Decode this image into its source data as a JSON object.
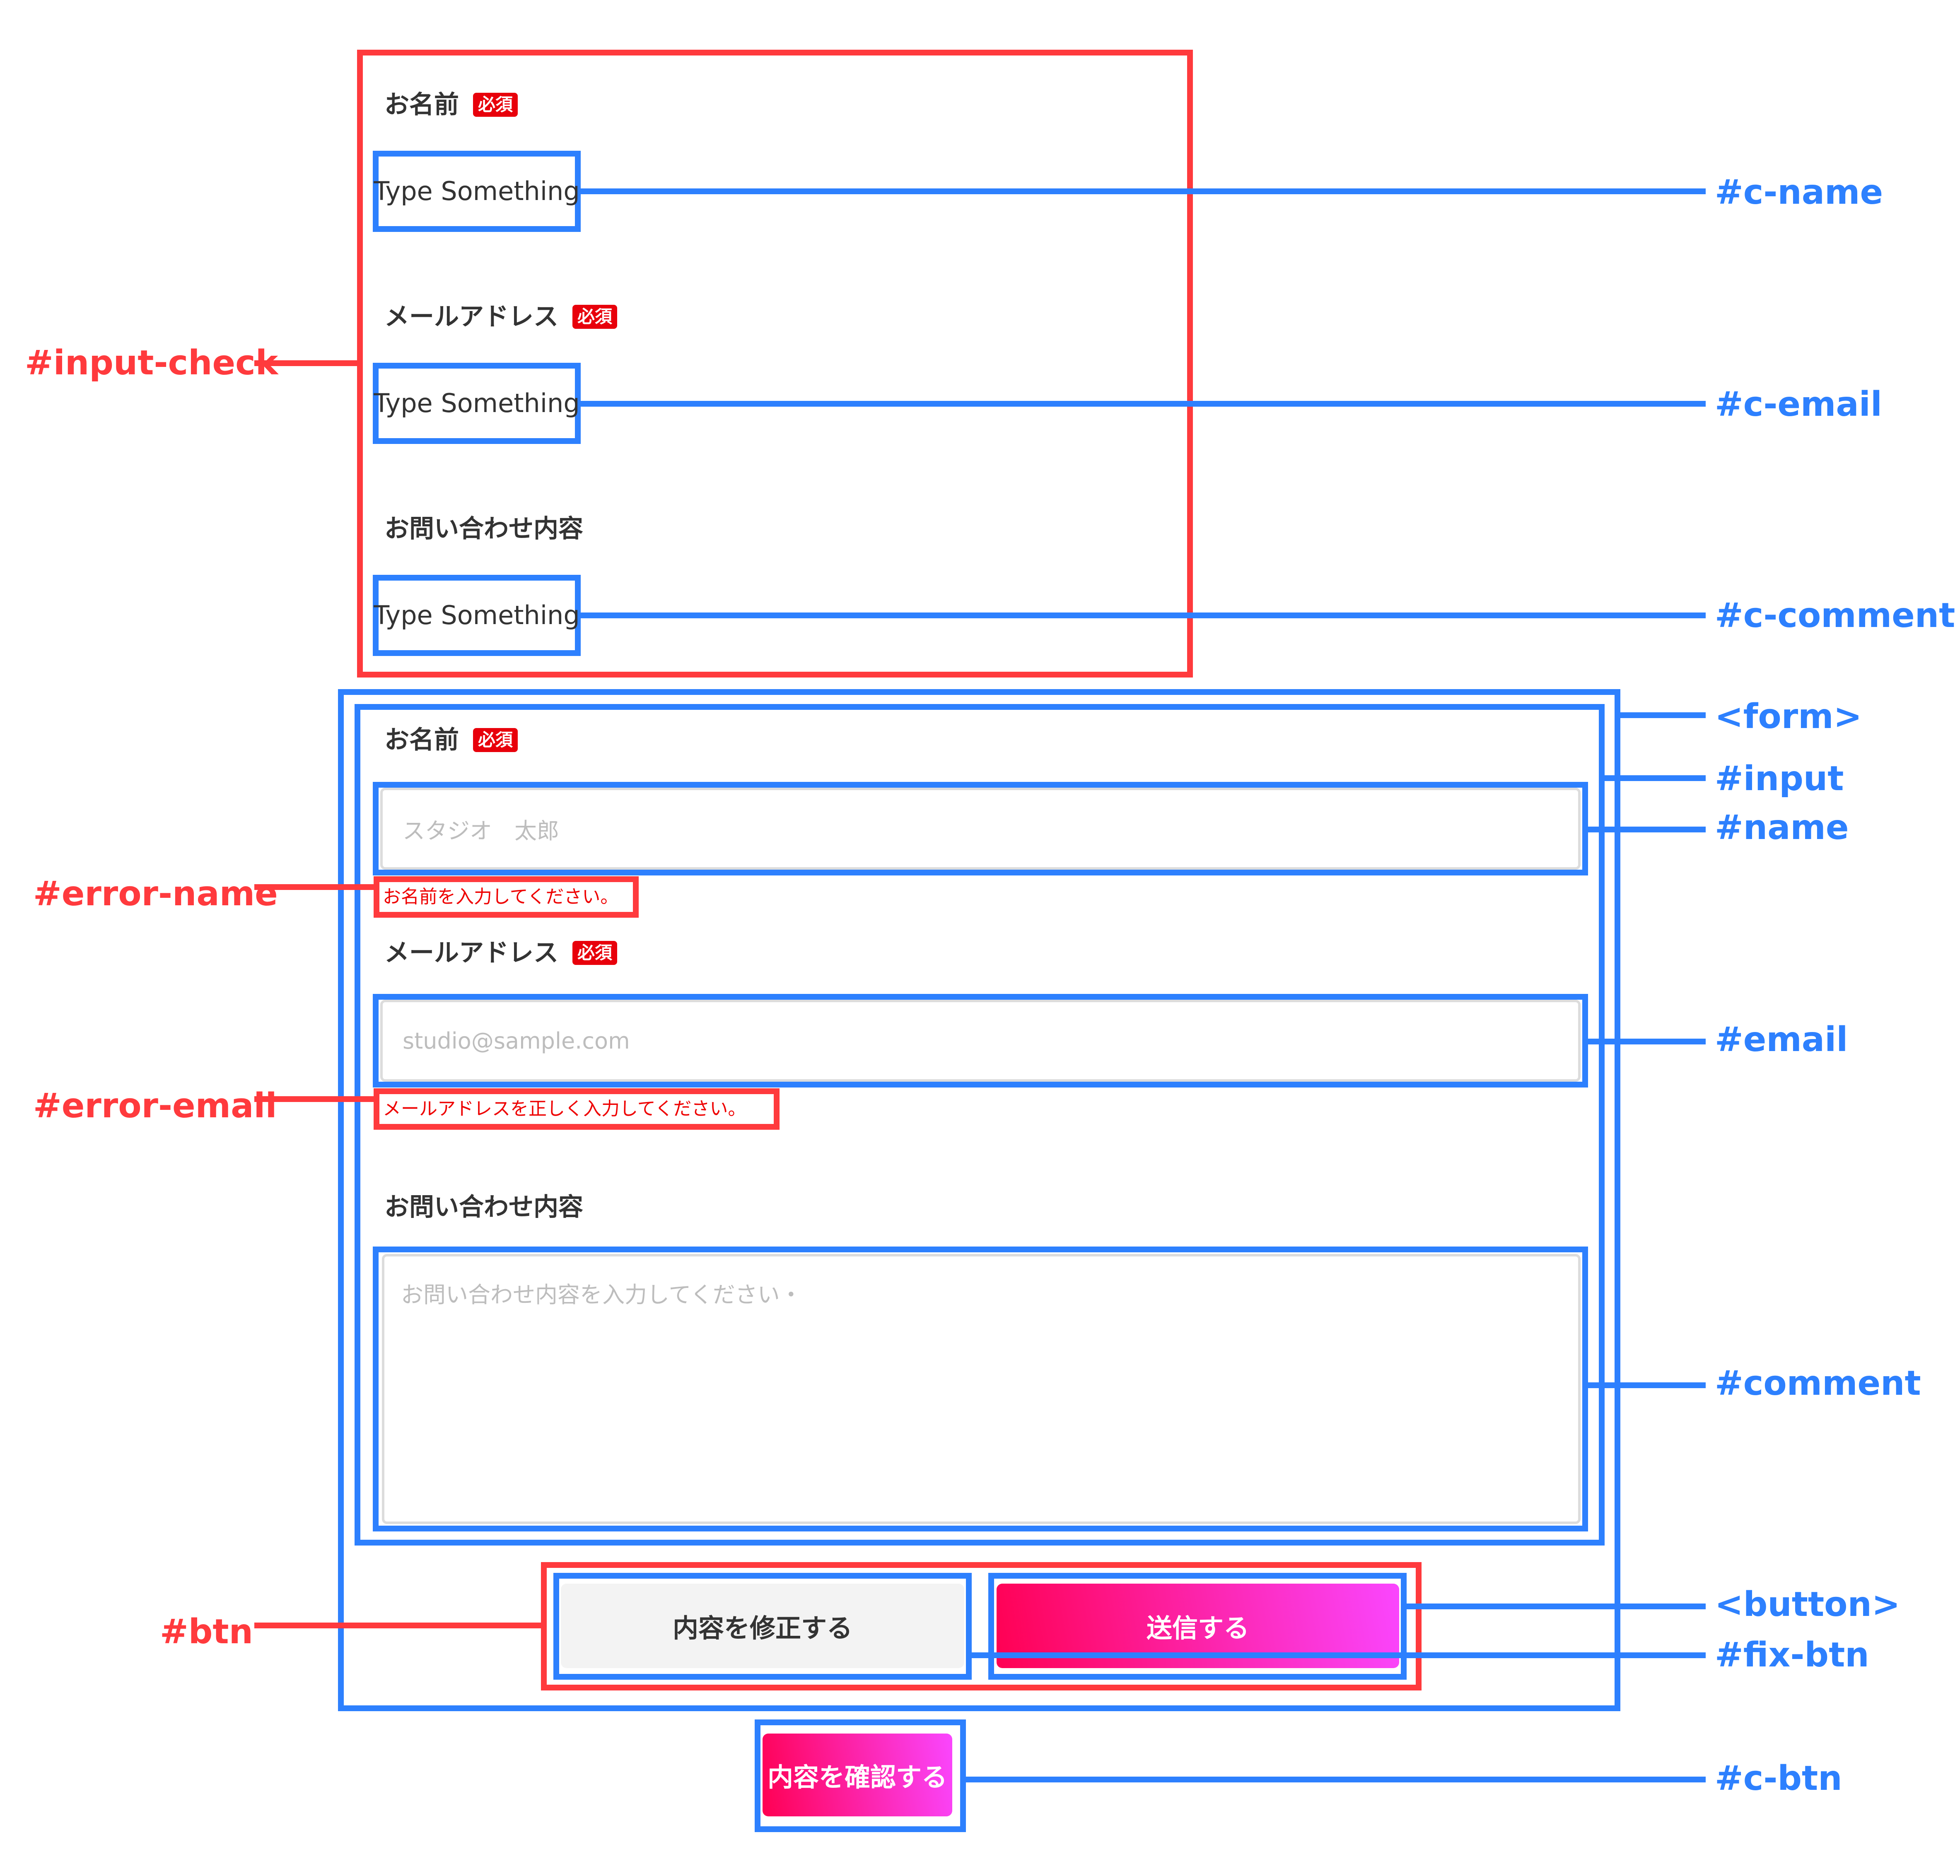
{
  "confirm_section": {
    "name_label": "お名前",
    "email_label": "メールアドレス",
    "comment_label": "お問い合わせ内容",
    "required_badge": "必須",
    "c_name_value": "Type Something",
    "c_email_value": "Type Something",
    "c_comment_value": "Type Something"
  },
  "form_section": {
    "name_label": "お名前",
    "email_label": "メールアドレス",
    "comment_label": "お問い合わせ内容",
    "required_badge": "必須",
    "name_placeholder": "スタジオ　太郎",
    "email_placeholder": "studio@sample.com",
    "comment_placeholder": "お問い合わせ内容を入力してください・",
    "error_name": "お名前を入力してください。",
    "error_email": "メールアドレスを正しく入力してください。",
    "fix_button": "内容を修正する",
    "submit_button": "送信する"
  },
  "confirm_button": "内容を確認する",
  "callouts": {
    "input_check": "#input-check",
    "error_name": "#error-name",
    "error_email": "#error-email",
    "btn": "#btn",
    "c_name": "#c-name",
    "c_email": "#c-email",
    "c_comment": "#c-comment",
    "form": "<form>",
    "input": "#input",
    "name": "#name",
    "email": "#email",
    "comment": "#comment",
    "button": "<button>",
    "fix_btn": "#fix-btn",
    "c_btn": "#c-btn"
  },
  "colors": {
    "annotation_red": "#ff3a3d",
    "annotation_blue": "#2d80fe",
    "required_badge": "#e8000b",
    "error_text": "#ee0000",
    "gradient_start": "#ff0052",
    "gradient_end": "#fa46ff"
  }
}
